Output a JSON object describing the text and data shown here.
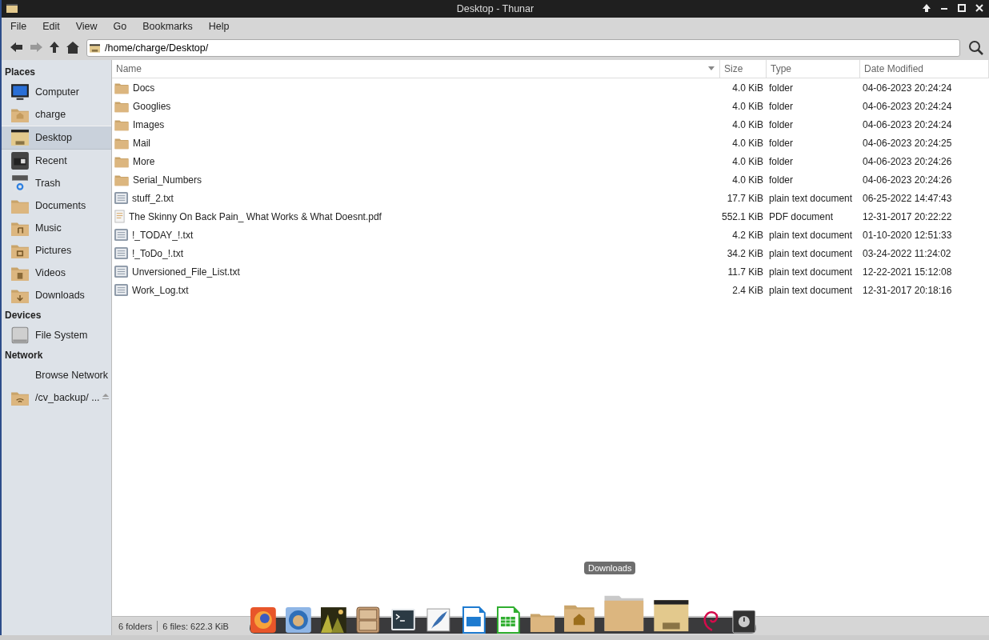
{
  "window": {
    "title": "Desktop - Thunar"
  },
  "menu": [
    "File",
    "Edit",
    "View",
    "Go",
    "Bookmarks",
    "Help"
  ],
  "location": {
    "value": "/home/charge/Desktop/"
  },
  "sidebar": [
    {
      "heading": "Places",
      "items": [
        {
          "label": "Computer",
          "kind": "computer",
          "selected": false
        },
        {
          "label": "charge",
          "kind": "home",
          "selected": false
        },
        {
          "label": "Desktop",
          "kind": "desktop",
          "selected": true
        },
        {
          "label": "Recent",
          "kind": "recent",
          "selected": false
        },
        {
          "label": "Trash",
          "kind": "trash",
          "selected": false
        },
        {
          "label": "Documents",
          "kind": "folder",
          "selected": false
        },
        {
          "label": "Music",
          "kind": "music",
          "selected": false
        },
        {
          "label": "Pictures",
          "kind": "pictures",
          "selected": false
        },
        {
          "label": "Videos",
          "kind": "videos",
          "selected": false
        },
        {
          "label": "Downloads",
          "kind": "downloads",
          "selected": false
        }
      ]
    },
    {
      "heading": "Devices",
      "items": [
        {
          "label": "File System",
          "kind": "drive",
          "selected": false
        }
      ]
    },
    {
      "heading": "Network",
      "items": [
        {
          "label": "Browse Network",
          "kind": "none",
          "selected": false
        },
        {
          "label": "/cv_backup/ ...",
          "kind": "network",
          "selected": false,
          "eject": true
        }
      ]
    }
  ],
  "table": {
    "columns": [
      "Name",
      "Size",
      "Type",
      "Date Modified"
    ],
    "rows": [
      {
        "kind": "folder",
        "name": "Docs",
        "size": "4.0 KiB",
        "type": "folder",
        "date": "04-06-2023 20:24:24"
      },
      {
        "kind": "folder",
        "name": "Googlies",
        "size": "4.0 KiB",
        "type": "folder",
        "date": "04-06-2023 20:24:24"
      },
      {
        "kind": "folder",
        "name": "Images",
        "size": "4.0 KiB",
        "type": "folder",
        "date": "04-06-2023 20:24:24"
      },
      {
        "kind": "folder",
        "name": "Mail",
        "size": "4.0 KiB",
        "type": "folder",
        "date": "04-06-2023 20:24:25"
      },
      {
        "kind": "folder",
        "name": "More",
        "size": "4.0 KiB",
        "type": "folder",
        "date": "04-06-2023 20:24:26"
      },
      {
        "kind": "folder",
        "name": "Serial_Numbers",
        "size": "4.0 KiB",
        "type": "folder",
        "date": "04-06-2023 20:24:26"
      },
      {
        "kind": "text",
        "name": "stuff_2.txt",
        "size": "17.7 KiB",
        "type": "plain text document",
        "date": "06-25-2022 14:47:43"
      },
      {
        "kind": "pdf",
        "name": "The Skinny On Back Pain_ What Works & What Doesnt.pdf",
        "size": "552.1 KiB",
        "type": "PDF document",
        "date": "12-31-2017 20:22:22"
      },
      {
        "kind": "text",
        "name": "!_TODAY_!.txt",
        "size": "4.2 KiB",
        "type": "plain text document",
        "date": "01-10-2020 12:51:33"
      },
      {
        "kind": "text",
        "name": "!_ToDo_!.txt",
        "size": "34.2 KiB",
        "type": "plain text document",
        "date": "03-24-2022 11:24:02"
      },
      {
        "kind": "text",
        "name": "Unversioned_File_List.txt",
        "size": "11.7 KiB",
        "type": "plain text document",
        "date": "12-22-2021 15:12:08"
      },
      {
        "kind": "text",
        "name": "Work_Log.txt",
        "size": "2.4 KiB",
        "type": "plain text document",
        "date": "12-31-2017 20:18:16"
      }
    ]
  },
  "status_bar": [
    "6 folders",
    "6 files: 622.3 KiB"
  ],
  "dock": {
    "tooltip": "Downloads",
    "items": [
      {
        "kind": "firefox"
      },
      {
        "kind": "mail"
      },
      {
        "kind": "picture"
      },
      {
        "kind": "cabinet"
      },
      {
        "kind": "terminal"
      },
      {
        "kind": "writer"
      },
      {
        "kind": "impress"
      },
      {
        "kind": "calc"
      },
      {
        "kind": "folder"
      },
      {
        "kind": "home"
      },
      {
        "kind": "bigfolder"
      },
      {
        "kind": "desktop"
      },
      {
        "kind": "swirl"
      },
      {
        "kind": "power"
      }
    ]
  }
}
